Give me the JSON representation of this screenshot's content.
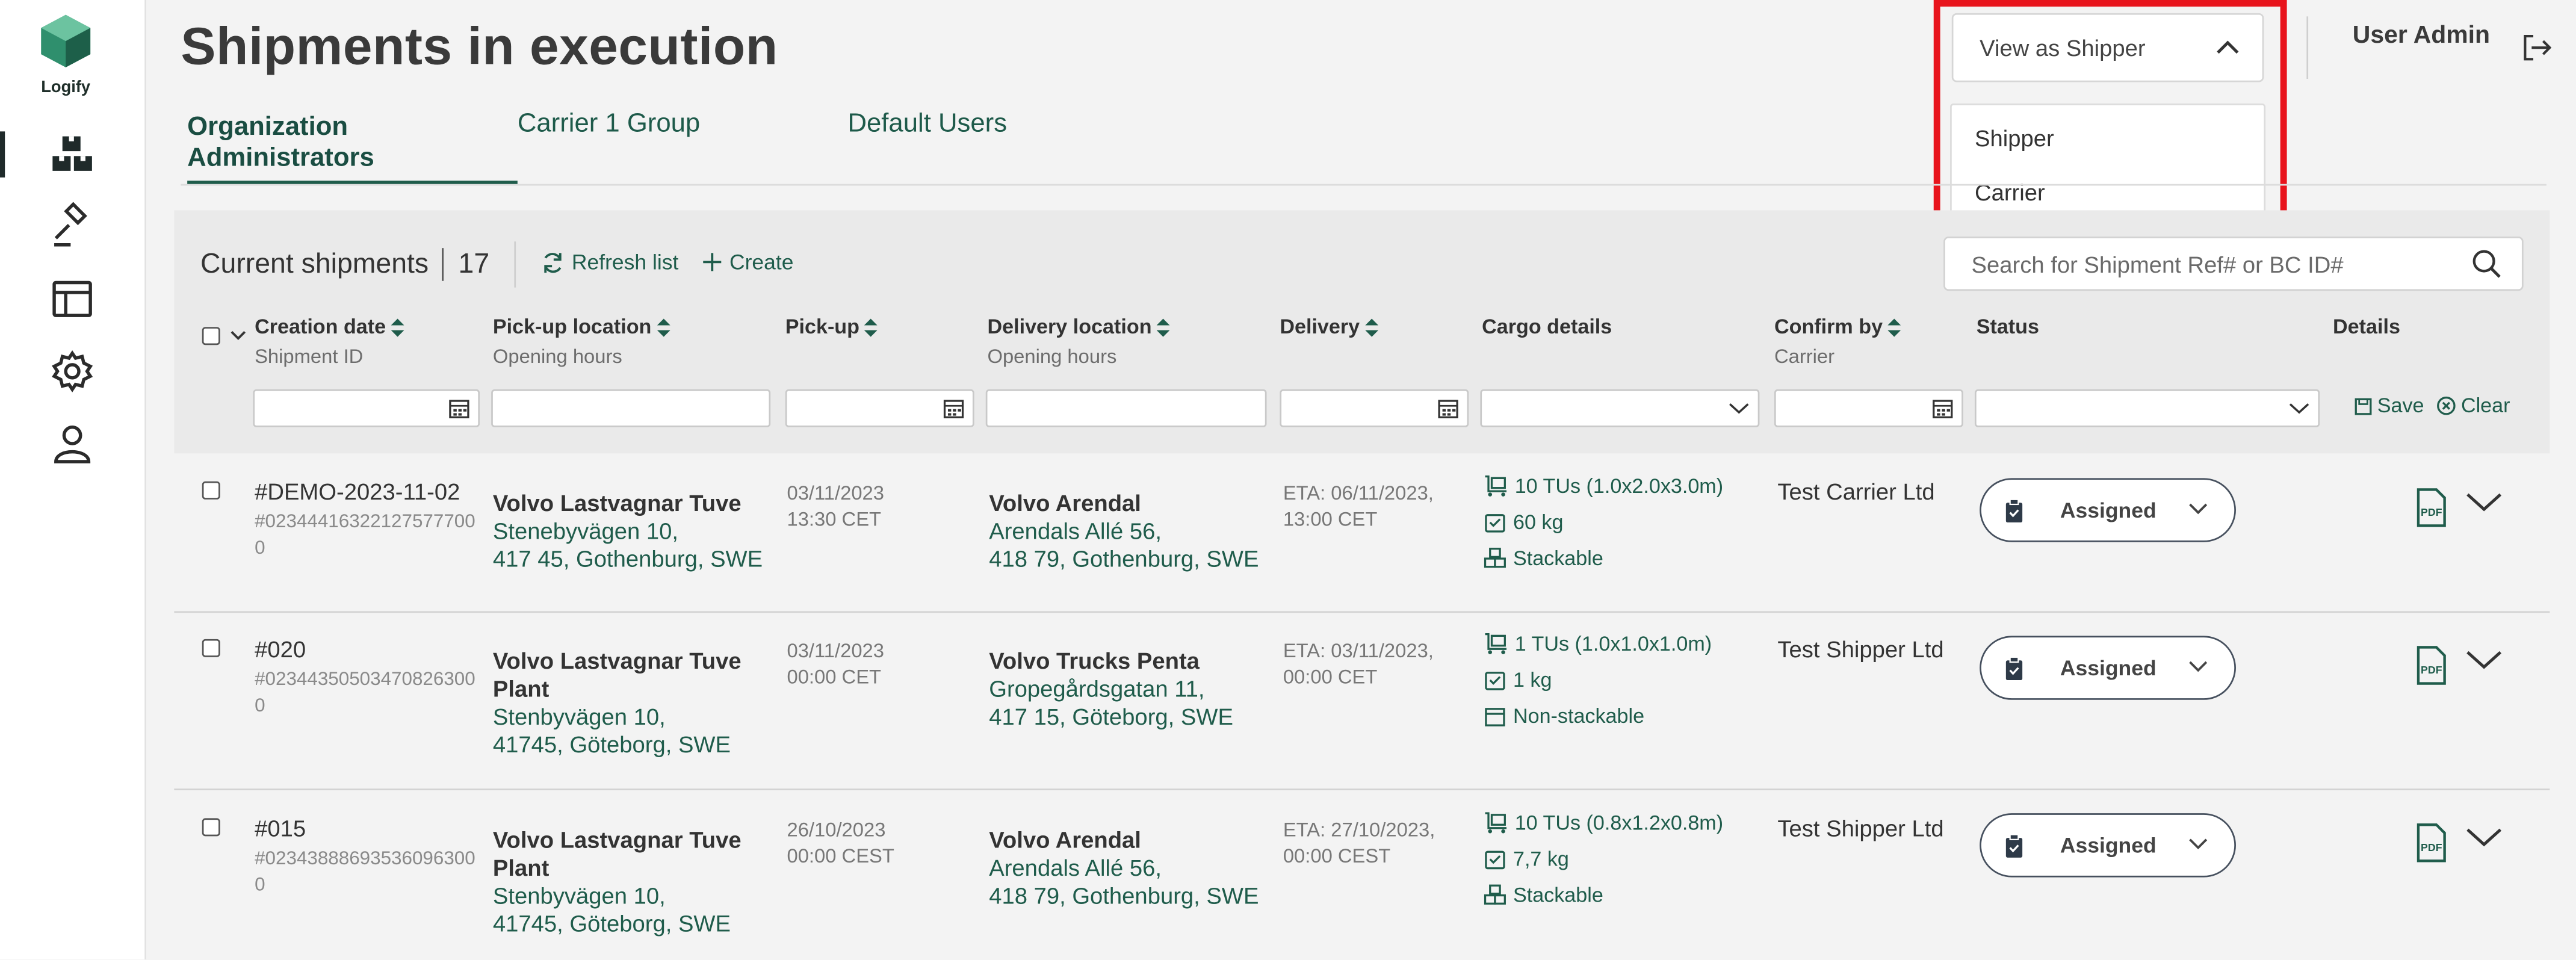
{
  "sidebar": {
    "logo_text": "Logify",
    "items": [
      {
        "name": "shipments-icon"
      },
      {
        "name": "auction-hammer-icon"
      },
      {
        "name": "layout-icon"
      },
      {
        "name": "settings-icon"
      },
      {
        "name": "user-icon"
      }
    ]
  },
  "header": {
    "title": "Shipments in execution",
    "view_as": {
      "selected": "View as Shipper",
      "options": [
        "Shipper",
        "Carrier"
      ]
    },
    "user": "User Admin"
  },
  "tabs": [
    {
      "label": "Organization Administrators",
      "active": true
    },
    {
      "label": "Carrier 1 Group",
      "active": false
    },
    {
      "label": "Default Users",
      "active": false
    }
  ],
  "toolbar": {
    "current_label": "Current shipments",
    "count": "17",
    "refresh_label": "Refresh list",
    "create_label": "Create",
    "search_placeholder": "Search for Shipment Ref# or BC ID#",
    "save_label": "Save",
    "clear_label": "Clear"
  },
  "columns": {
    "creation": {
      "title": "Creation date",
      "sub": "Shipment ID"
    },
    "pickup_location": {
      "title": "Pick-up location",
      "sub": "Opening hours"
    },
    "pickup": {
      "title": "Pick-up"
    },
    "delivery_location": {
      "title": "Delivery location",
      "sub": "Opening hours"
    },
    "delivery": {
      "title": "Delivery"
    },
    "cargo": {
      "title": "Cargo details"
    },
    "confirm": {
      "title": "Confirm by",
      "sub": "Carrier"
    },
    "status": {
      "title": "Status"
    },
    "details": {
      "title": "Details"
    }
  },
  "rows": [
    {
      "id": "#DEMO-2023-11-02",
      "bc_id": "#023444163221275777000",
      "pickup_name": "Volvo Lastvagnar Tuve",
      "pickup_addr1": "Stenebyvägen 10,",
      "pickup_addr2": "417 45, Gothenburg, SWE",
      "pickup_date": "03/11/2023",
      "pickup_time": "13:30 CET",
      "delivery_name": "Volvo Arendal",
      "delivery_addr1": "Arendals Allé 56,",
      "delivery_addr2": "418 79, Gothenburg, SWE",
      "eta_line1": "ETA:  06/11/2023,",
      "eta_line2": "13:00 CET",
      "cargo_tus": "10 TUs (1.0x2.0x3.0m)",
      "cargo_weight": "60 kg",
      "cargo_stack": "Stackable",
      "confirm": "Test Carrier Ltd",
      "status": "Assigned"
    },
    {
      "id": "#020",
      "bc_id": "#023443505034708263000",
      "pickup_name": "Volvo Lastvagnar Tuve Plant",
      "pickup_addr1": "Stenbyvägen 10,",
      "pickup_addr2": "41745, Göteborg, SWE",
      "pickup_date": "03/11/2023",
      "pickup_time": "00:00 CET",
      "delivery_name": "Volvo Trucks Penta",
      "delivery_addr1": "Gropegårdsgatan 11,",
      "delivery_addr2": "417 15, Göteborg, SWE",
      "eta_line1": "ETA:  03/11/2023,",
      "eta_line2": "00:00 CET",
      "cargo_tus": "1 TUs (1.0x1.0x1.0m)",
      "cargo_weight": "1 kg",
      "cargo_stack": "Non-stackable",
      "confirm": "Test Shipper Ltd",
      "status": "Assigned"
    },
    {
      "id": "#015",
      "bc_id": "#023438886935360963000",
      "pickup_name": "Volvo Lastvagnar Tuve Plant",
      "pickup_addr1": "Stenbyvägen 10,",
      "pickup_addr2": "41745, Göteborg, SWE",
      "pickup_date": "26/10/2023",
      "pickup_time": "00:00 CEST",
      "delivery_name": "Volvo Arendal",
      "delivery_addr1": "Arendals Allé 56,",
      "delivery_addr2": "418 79, Gothenburg, SWE",
      "eta_line1": "ETA:  27/10/2023,",
      "eta_line2": "00:00 CEST",
      "cargo_tus": "10 TUs (0.8x1.2x0.8m)",
      "cargo_weight": "7,7 kg",
      "cargo_stack": "Stackable",
      "confirm": "Test Shipper Ltd",
      "status": "Assigned"
    }
  ],
  "colors": {
    "brand_green": "#1f5c4b",
    "highlight_red": "#e8141c"
  }
}
